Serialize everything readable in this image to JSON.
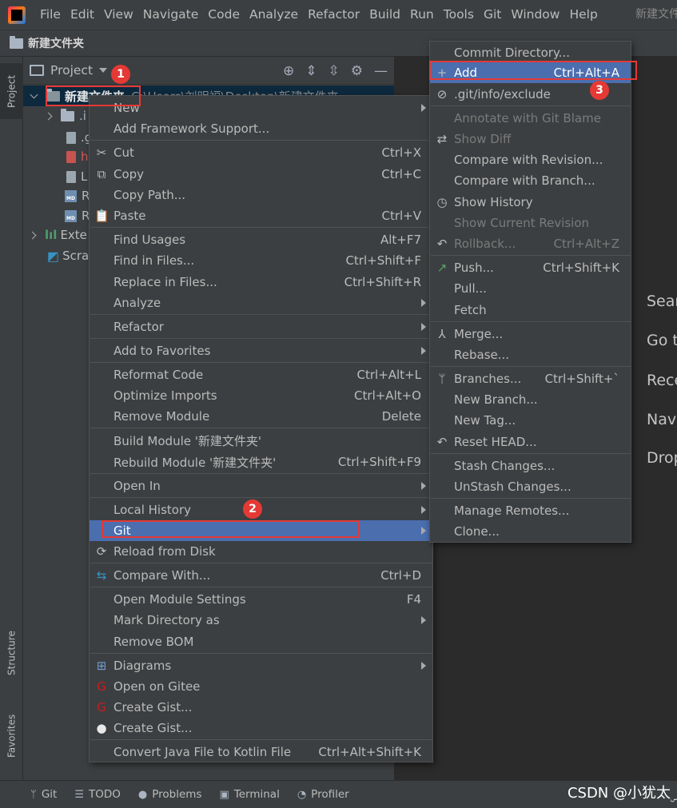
{
  "menubar": {
    "items": [
      "File",
      "Edit",
      "View",
      "Navigate",
      "Code",
      "Analyze",
      "Refactor",
      "Build",
      "Run",
      "Tools",
      "Git",
      "Window",
      "Help"
    ],
    "title": "新建文件"
  },
  "breadcrumb": {
    "label": "新建文件夹"
  },
  "left_stripe": {
    "tabs": [
      "Project",
      "Structure",
      "Favorites"
    ]
  },
  "project_panel": {
    "title": "Project",
    "root_label": "新建文件夹",
    "root_path": "C:\\Users\\刘明福\\Desktop\\新建文件夹",
    "tree": [
      {
        "label": ".i",
        "icon": "folder-icon"
      },
      {
        "label": ".g",
        "icon": "gitignore-icon"
      },
      {
        "label": "h",
        "icon": "file-icon"
      },
      {
        "label": "L",
        "icon": "license-icon"
      },
      {
        "label": "R",
        "icon": "markdown-icon"
      },
      {
        "label": "R",
        "icon": "markdown-icon"
      },
      {
        "label": "Exte",
        "icon": "library-icon"
      },
      {
        "label": "Scra",
        "icon": "scratch-icon"
      }
    ]
  },
  "context_menu": {
    "items": [
      {
        "label": "New",
        "submenu": true
      },
      {
        "label": "Add Framework Support..."
      },
      {
        "label": "Cut",
        "shortcut": "Ctrl+X",
        "icon": "✂"
      },
      {
        "label": "Copy",
        "shortcut": "Ctrl+C",
        "icon": "⧉"
      },
      {
        "label": "Copy Path..."
      },
      {
        "label": "Paste",
        "shortcut": "Ctrl+V",
        "icon": "📋"
      },
      {
        "label": "Find Usages",
        "shortcut": "Alt+F7"
      },
      {
        "label": "Find in Files...",
        "shortcut": "Ctrl+Shift+F"
      },
      {
        "label": "Replace in Files...",
        "shortcut": "Ctrl+Shift+R"
      },
      {
        "label": "Analyze",
        "submenu": true
      },
      {
        "label": "Refactor",
        "submenu": true
      },
      {
        "label": "Add to Favorites",
        "submenu": true
      },
      {
        "label": "Reformat Code",
        "shortcut": "Ctrl+Alt+L"
      },
      {
        "label": "Optimize Imports",
        "shortcut": "Ctrl+Alt+O"
      },
      {
        "label": "Remove Module",
        "shortcut": "Delete"
      },
      {
        "label": "Build Module '新建文件夹'"
      },
      {
        "label": "Rebuild Module '新建文件夹'",
        "shortcut": "Ctrl+Shift+F9"
      },
      {
        "label": "Open In",
        "submenu": true
      },
      {
        "label": "Local History",
        "submenu": true
      },
      {
        "label": "Git",
        "submenu": true
      },
      {
        "label": "Reload from Disk",
        "icon": "⟳"
      },
      {
        "label": "Compare With...",
        "shortcut": "Ctrl+D",
        "icon": "⇆"
      },
      {
        "label": "Open Module Settings",
        "shortcut": "F4"
      },
      {
        "label": "Mark Directory as",
        "submenu": true
      },
      {
        "label": "Remove BOM"
      },
      {
        "label": "Diagrams",
        "submenu": true,
        "icon": "⊞"
      },
      {
        "label": "Open on Gitee",
        "icon": "G"
      },
      {
        "label": "Create Gist...",
        "icon": "G"
      },
      {
        "label": "Create Gist...",
        "icon": "●"
      },
      {
        "label": "Convert Java File to Kotlin File",
        "shortcut": "Ctrl+Alt+Shift+K"
      }
    ]
  },
  "git_submenu": {
    "items": [
      {
        "label": "Commit Directory..."
      },
      {
        "label": "Add",
        "shortcut": "Ctrl+Alt+A",
        "icon": "+"
      },
      {
        "label": ".git/info/exclude",
        "icon": "⊘"
      },
      {
        "label": "Annotate with Git Blame"
      },
      {
        "label": "Show Diff",
        "icon": "⇄"
      },
      {
        "label": "Compare with Revision..."
      },
      {
        "label": "Compare with Branch..."
      },
      {
        "label": "Show History",
        "icon": "◷"
      },
      {
        "label": "Show Current Revision"
      },
      {
        "label": "Rollback...",
        "shortcut": "Ctrl+Alt+Z",
        "icon": "↶"
      },
      {
        "label": "Push...",
        "shortcut": "Ctrl+Shift+K",
        "icon": "↗"
      },
      {
        "label": "Pull..."
      },
      {
        "label": "Fetch"
      },
      {
        "label": "Merge...",
        "icon": "⅄"
      },
      {
        "label": "Rebase..."
      },
      {
        "label": "Branches...",
        "shortcut": "Ctrl+Shift+`",
        "icon": "ᛘ"
      },
      {
        "label": "New Branch..."
      },
      {
        "label": "New Tag..."
      },
      {
        "label": "Reset HEAD...",
        "icon": "↶"
      },
      {
        "label": "Stash Changes..."
      },
      {
        "label": "UnStash Changes..."
      },
      {
        "label": "Manage Remotes..."
      },
      {
        "label": "Clone..."
      }
    ]
  },
  "editor_hints": [
    "Sear",
    "Go t",
    "Rece",
    "Nav",
    "Drop"
  ],
  "badges": [
    "1",
    "2",
    "3"
  ],
  "bottom_bar": {
    "items": [
      {
        "label": "Git",
        "icon": "ᛘ"
      },
      {
        "label": "TODO",
        "icon": "☰"
      },
      {
        "label": "Problems",
        "icon": "●"
      },
      {
        "label": "Terminal",
        "icon": "▣"
      },
      {
        "label": "Profiler",
        "icon": "◔"
      }
    ]
  },
  "watermark": "CSDN @小犹太ۣ"
}
